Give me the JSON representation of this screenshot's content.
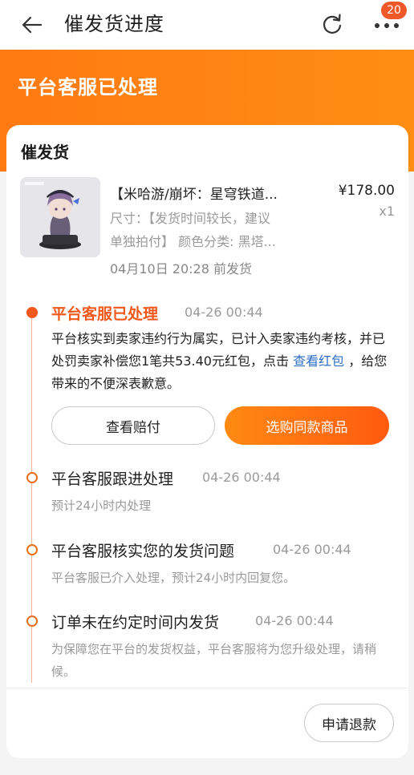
{
  "nav": {
    "title": "催发货进度",
    "badge_count": "20",
    "icons": [
      "back-arrow-icon",
      "refresh-icon",
      "more-icon"
    ]
  },
  "header": {
    "status_title": "平台客服已处理"
  },
  "card": {
    "title": "催发货",
    "product": {
      "name": "【米哈游/崩坏：星穹铁道...",
      "price": "¥178.00",
      "quantity": "x1",
      "spec_line1": "尺寸：【发货时间较长，建议",
      "spec_line2": "单独拍付】 颜色分类: 黑塔...",
      "promise_date": "04月10日 20:28 前发货"
    }
  },
  "timeline": [
    {
      "title": "平台客服已处理",
      "time": "04-26 00:44",
      "desc_before_link": "平台核实到卖家违约行为属实，已计入卖家违约考核，并已处罚卖家补偿您1笔共53.40元红包，点击",
      "link": "查看红包",
      "desc_after_link": "，给您带来的不便深表歉意。",
      "active": true
    },
    {
      "title": "平台客服跟进处理",
      "time": "04-26 00:44",
      "desc": "预计24小时内处理"
    },
    {
      "title": "平台客服核实您的发货问题",
      "time": "04-26 00:44",
      "desc": "平台客服已介入处理，预计24小时内回复您。"
    },
    {
      "title": "订单未在约定时间内发货",
      "time": "04-26 00:44",
      "desc": "为保障您在平台的发货权益，平台客服将为您升级处理，请稍候。"
    }
  ],
  "actions": {
    "view_compensation": "查看赔付",
    "buy_same": "选购同款商品",
    "request_refund": "申请退款"
  },
  "colors": {
    "accent": "#f1581b",
    "header_orange": "#ff8412",
    "link": "#2d6fc4"
  }
}
